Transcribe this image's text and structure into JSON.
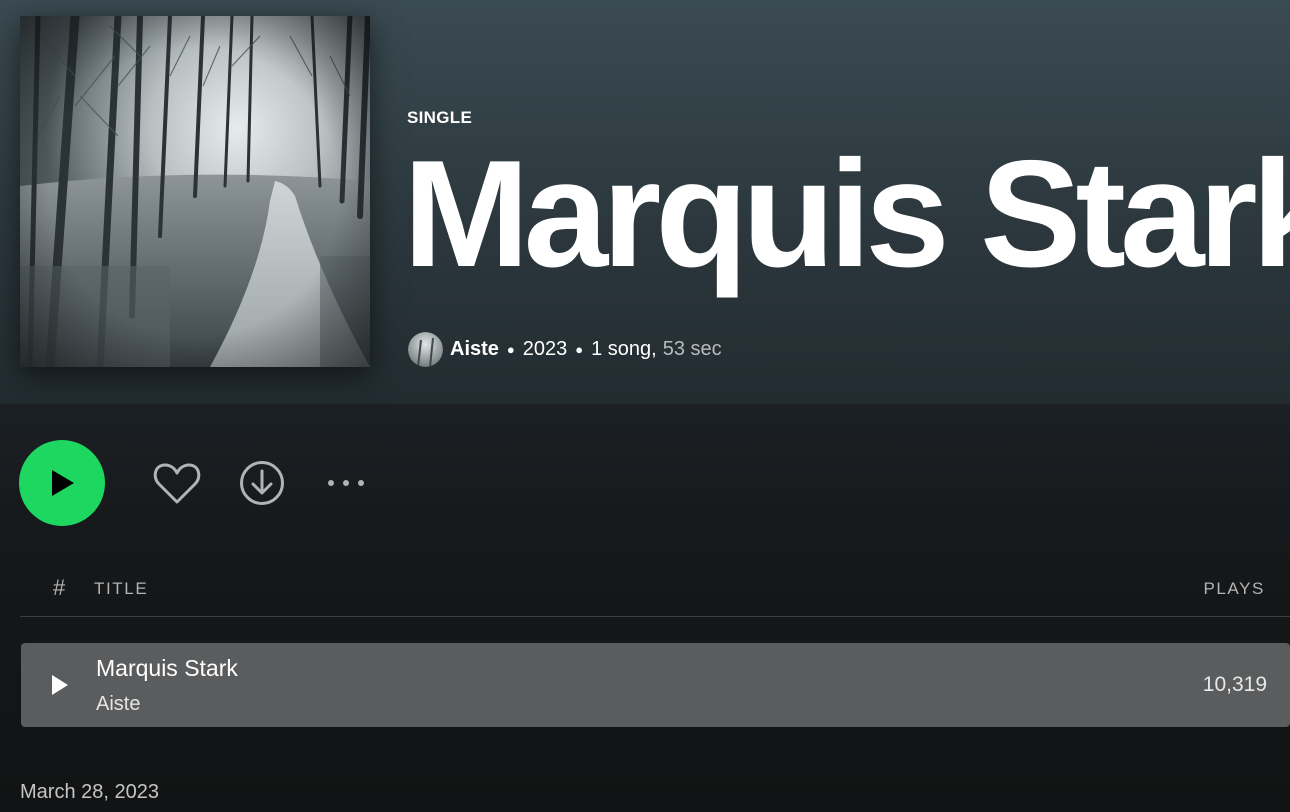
{
  "album": {
    "type_label": "SINGLE",
    "title": "Marquis Stark",
    "artist": "Aiste",
    "year": "2023",
    "song_count": "1 song,",
    "duration": "53 sec",
    "release_date": "March 28, 2023"
  },
  "controls": {
    "play_icon": "play-icon",
    "like_icon": "heart-icon",
    "download_icon": "download-icon",
    "more_icon": "more-options-icon"
  },
  "table": {
    "headers": {
      "number": "#",
      "title": "TITLE",
      "plays": "PLAYS"
    },
    "rows": [
      {
        "name": "Marquis Stark",
        "artist": "Aiste",
        "plays": "10,319"
      }
    ]
  },
  "colors": {
    "accent": "#1ed760",
    "hero_bg": "#3b4b52",
    "row_highlight": "#5b5c5d"
  }
}
